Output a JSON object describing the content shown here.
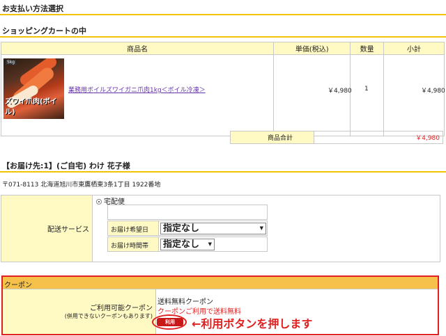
{
  "page_title": "お支払い方法選択",
  "cart_section_title": "ショッピングカートの中",
  "cart_headers": {
    "name": "商品名",
    "unit_price": "単価(税込)",
    "qty": "数量",
    "subtotal": "小計"
  },
  "item": {
    "image_tag": "5kg",
    "image_caption": "ズワイ爪肉(ボイル)",
    "name": "業務用ボイルズワイガニ爪肉1kg＜ボイル冷凍＞",
    "unit_price": "￥4,980",
    "qty": "1",
    "subtotal": "￥4,980"
  },
  "total": {
    "label": "商品合計",
    "value": "￥4,980"
  },
  "delivery_title": "【お届け先:1】(ご自宅) わけ 花子様",
  "address": "〒071-8113 北海道旭川市東鷹栖東3条1丁目 1922番地",
  "shipping": {
    "label": "配送サービス",
    "method": "宅配便",
    "date_label": "お届け希望日",
    "date_value": "指定なし",
    "time_label": "お届け時間帯",
    "time_value": "指定なし"
  },
  "coupon": {
    "header": "クーポン",
    "available_label": "ご利用可能クーポン",
    "note": "(併用できないクーポンもあります)",
    "coupon_title": "送料無料クーポン",
    "coupon_link": "クーポンご利用で送料無料",
    "use_button": "利用",
    "annotation": "←利用ボタンを押します"
  },
  "colors": {
    "accent_yellow": "#f0c400",
    "header_bg": "#fff9c4",
    "red": "#e02020"
  }
}
